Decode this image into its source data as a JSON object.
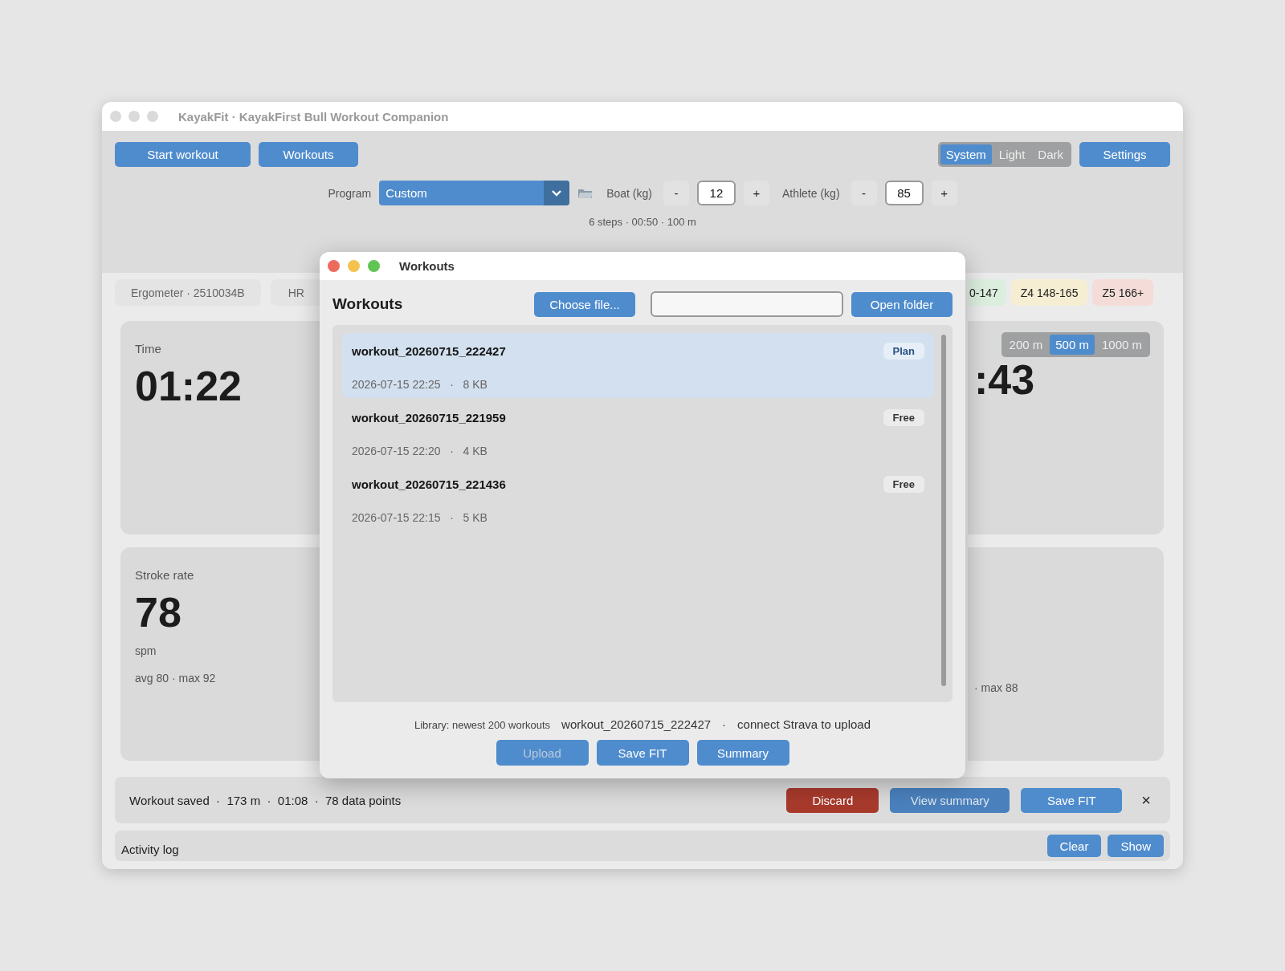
{
  "window": {
    "title": "KayakFit · KayakFirst Bull Workout Companion"
  },
  "toolbar": {
    "buttons": [
      "Start workout",
      "Workouts"
    ],
    "theme": [
      {
        "label": "System",
        "selected": true
      },
      {
        "label": "Light",
        "selected": false
      },
      {
        "label": "Dark",
        "selected": false
      }
    ],
    "settings": "Settings"
  },
  "program": {
    "label": "Program",
    "value": "Custom"
  },
  "weights": [
    {
      "label": "Boat (kg)",
      "minus": "-",
      "value": "12",
      "plus": "+"
    },
    {
      "label": "Athlete (kg)",
      "minus": "-",
      "value": "85",
      "plus": "+"
    }
  ],
  "program_summary": "6 steps · 00:50 · 100 m",
  "chips_left": [
    {
      "text": "Ergometer · 2510034B",
      "color": "#e4e4e4"
    },
    {
      "text": "HR",
      "color": "#e4e4e4"
    }
  ],
  "chips_right": [
    {
      "text": "0-147",
      "color": "#dcefdf"
    },
    {
      "text": "Z4  148-165",
      "color": "#f6eed2"
    },
    {
      "text": "Z5  166+",
      "color": "#f4dcd8"
    }
  ],
  "cards_left": [
    {
      "label": "Time",
      "value": "01:22"
    },
    {
      "label": "Stroke rate",
      "value": "78",
      "unit": "spm",
      "stats": "avg 80  ·  max 92"
    }
  ],
  "cards_right": [
    {
      "value": ":43",
      "pace_options": [
        {
          "label": "200 m",
          "selected": false
        },
        {
          "label": "500 m",
          "selected": true
        },
        {
          "label": "1000 m",
          "selected": false
        }
      ]
    },
    {
      "stats": "·  max 88"
    }
  ],
  "saved_bar": {
    "text": "Workout saved  ·  173 m  ·  01:08  ·  78 data points",
    "buttons": [
      {
        "label": "Discard",
        "kind": "danger"
      },
      {
        "label": "View summary",
        "kind": "muted"
      },
      {
        "label": "Save FIT",
        "kind": "primary"
      }
    ],
    "close": "×"
  },
  "activity_log": {
    "title": "Activity log",
    "buttons": [
      "Clear",
      "Show"
    ]
  },
  "dialog": {
    "title": "Workouts",
    "heading": "Workouts",
    "choose": "Choose file...",
    "open": "Open folder",
    "files": [
      {
        "name": "workout_20260715_222427",
        "date": "2026-07-15 22:25",
        "size": "8 KB",
        "sep": "·",
        "tag": "Plan",
        "selected": true
      },
      {
        "name": "workout_20260715_221959",
        "date": "2026-07-15 22:20",
        "size": "4 KB",
        "sep": "·",
        "tag": "Free",
        "selected": false
      },
      {
        "name": "workout_20260715_221436",
        "date": "2026-07-15 22:15",
        "size": "5 KB",
        "sep": "·",
        "tag": "Free",
        "selected": false
      }
    ],
    "footer": {
      "library": "Library: newest 200 workouts",
      "selected_file": "workout_20260715_222427",
      "sep": "·",
      "note": "connect Strava to upload"
    },
    "actions": [
      {
        "label": "Upload",
        "disabled": true
      },
      {
        "label": "Save FIT",
        "disabled": false
      },
      {
        "label": "Summary",
        "disabled": false
      }
    ]
  }
}
